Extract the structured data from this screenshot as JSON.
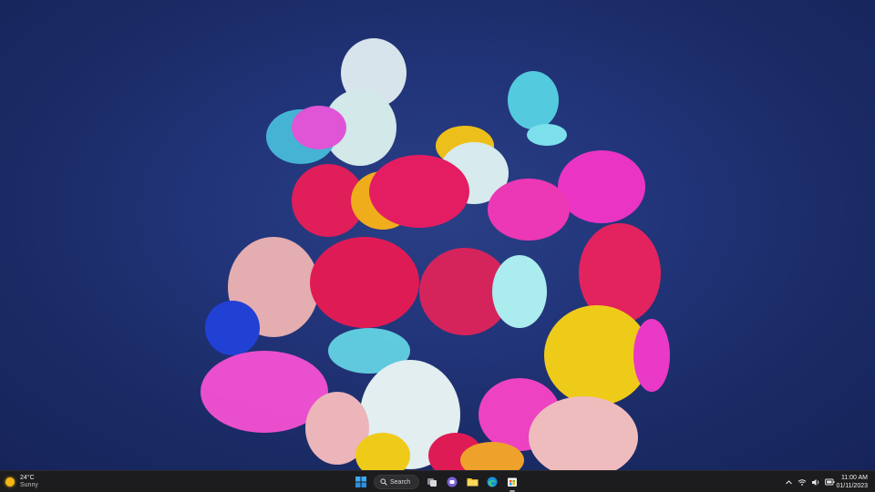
{
  "taskbar": {
    "weather": {
      "icon": "sun-icon",
      "temperature": "24°C",
      "condition": "Sunny"
    },
    "search": {
      "label": "Search"
    },
    "apps": [
      {
        "name": "start-button",
        "icon": "windows-logo-icon"
      },
      {
        "name": "search-button",
        "icon": "search-icon"
      },
      {
        "name": "task-view-button",
        "icon": "task-view-icon"
      },
      {
        "name": "teams-chat-button",
        "icon": "teams-icon"
      },
      {
        "name": "file-explorer-button",
        "icon": "folder-icon"
      },
      {
        "name": "edge-button",
        "icon": "edge-icon"
      },
      {
        "name": "store-button",
        "icon": "store-icon"
      }
    ],
    "tray": {
      "icons": [
        "chevron-up-icon",
        "wifi-icon",
        "volume-icon",
        "battery-icon"
      ]
    },
    "clock": {
      "time": "11:00 AM",
      "date": "01/11/2023"
    }
  },
  "colors": {
    "desktop_background": "#22357a",
    "taskbar_background": "#1c1c1e",
    "accent": "#0a84ff"
  }
}
